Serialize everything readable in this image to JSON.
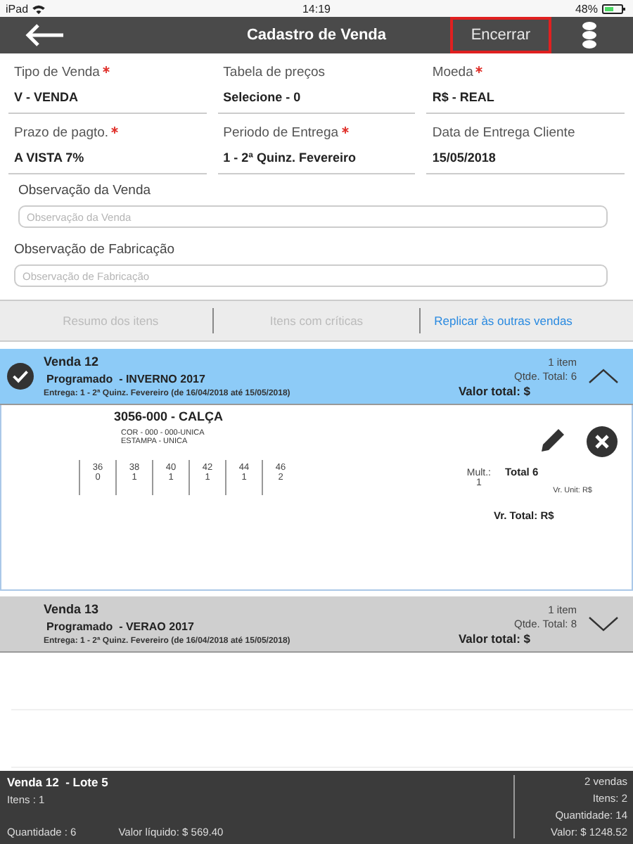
{
  "status_bar": {
    "device": "iPad",
    "time": "14:19",
    "battery": "48%"
  },
  "nav": {
    "title": "Cadastro de Venda",
    "action": {
      "label": "Encerrar",
      "highlighted": true
    }
  },
  "fields": [
    {
      "label": "Tipo de Venda",
      "required": true,
      "value": "V - VENDA"
    },
    {
      "label": "Tabela de preços",
      "required": false,
      "value": "Selecione - 0"
    },
    {
      "label": "Moeda",
      "required": true,
      "value": "R$ - REAL"
    },
    {
      "label": "Prazo de pagto.",
      "required": true,
      "value": "A VISTA 7%"
    },
    {
      "label": "Periodo de Entrega",
      "required": true,
      "value": "1 - 2ª Quinz. Fevereiro"
    },
    {
      "label": "Data de Entrega Cliente",
      "required": false,
      "value": "15/05/2018"
    }
  ],
  "notes": [
    {
      "label": "Observação da Venda",
      "placeholder": "Observação da Venda"
    },
    {
      "label": "Observação de Fabricação",
      "placeholder": "Observação de Fabricação"
    }
  ],
  "segments": [
    {
      "label": "Resumo dos itens",
      "disabled": true
    },
    {
      "label": "Itens com críticas",
      "disabled": true
    },
    {
      "label": "Replicar às outras vendas",
      "disabled": false
    }
  ],
  "sales": [
    {
      "title": "Venda 12",
      "program": "Programado  - INVERNO 2017",
      "delivery": "Entrega: 1 - 2ª Quinz. Fevereiro (de 16/04/2018 até 15/05/2018)",
      "items": "1 item",
      "quantity": "Qtde. Total: 6",
      "value": "Valor total: $",
      "selected": true,
      "expanded": true,
      "products": [
        {
          "name": "3056-000 - CALÇA",
          "details": [
            "COR - 000 - 000-UNICA",
            "ESTAMPA - UNICA"
          ],
          "sizes": [
            {
              "size": "36",
              "qty": "0"
            },
            {
              "size": "38",
              "qty": "1"
            },
            {
              "size": "40",
              "qty": "1"
            },
            {
              "size": "42",
              "qty": "1"
            },
            {
              "size": "44",
              "qty": "1"
            },
            {
              "size": "46",
              "qty": "2"
            }
          ],
          "mult_label": "Mult.:",
          "mult": "1",
          "total": "Total 6",
          "unit": "Vr. Unit: R$",
          "value": "Vr. Total: R$"
        }
      ]
    },
    {
      "title": "Venda 13",
      "program": "Programado  - VERAO 2017",
      "delivery": "Entrega: 1 - 2ª Quinz. Fevereiro (de 16/04/2018 até 15/05/2018)",
      "items": "1 item",
      "quantity": "Qtde. Total: 8",
      "value": "Valor total: $",
      "selected": false,
      "expanded": false
    }
  ],
  "footer": {
    "title": "Venda 12  - Lote 5",
    "items": "Itens : 1",
    "quantity": "Quantidade : 6",
    "net_value": "Valor líquido: $ 569.40",
    "summary": [
      "2 vendas",
      "Itens: 2",
      "Quantidade: 14",
      "Valor: $ 1248.52"
    ]
  }
}
